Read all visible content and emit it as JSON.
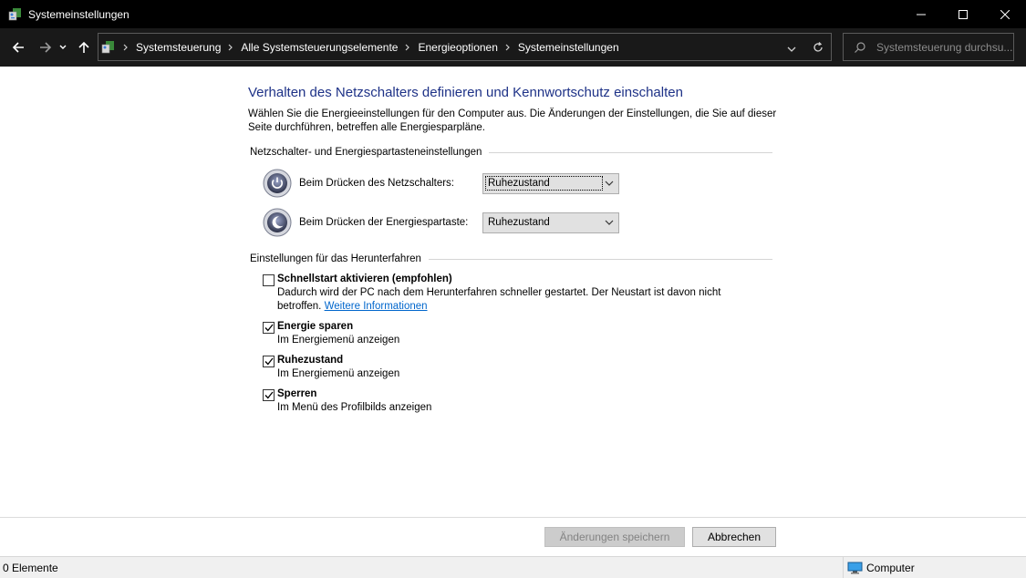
{
  "window": {
    "title": "Systemeinstellungen",
    "controls": [
      "minimize-icon",
      "maximize-icon",
      "close-icon"
    ]
  },
  "address": {
    "breadcrumbs": [
      "Systemsteuerung",
      "Alle Systemsteuerungselemente",
      "Energieoptionen",
      "Systemeinstellungen"
    ],
    "search_placeholder": "Systemsteuerung durchsu..."
  },
  "page": {
    "title": "Verhalten des Netzschalters definieren und Kennwortschutz einschalten",
    "description": "Wählen Sie die Energieeinstellungen für den Computer aus. Die Änderungen der Einstellungen, die Sie auf dieser Seite durchführen, betreffen alle Energiesparpläne."
  },
  "power_section": {
    "header": "Netzschalter- und Energiespartasteneinstellungen",
    "settings": [
      {
        "label": "Beim Drücken des Netzschalters:",
        "value": "Ruhezustand",
        "icon": "power-button-icon"
      },
      {
        "label": "Beim Drücken der Energiespartaste:",
        "value": "Ruhezustand",
        "icon": "sleep-button-icon"
      }
    ]
  },
  "shutdown_section": {
    "header": "Einstellungen für das Herunterfahren",
    "items": [
      {
        "label": "Schnellstart aktivieren (empfohlen)",
        "checked": false,
        "desc": "Dadurch wird der PC nach dem Herunterfahren schneller gestartet. Der Neustart ist davon nicht betroffen.",
        "link": "Weitere Informationen"
      },
      {
        "label": "Energie sparen",
        "checked": true,
        "desc": "Im Energiemenü anzeigen"
      },
      {
        "label": "Ruhezustand",
        "checked": true,
        "desc": "Im Energiemenü anzeigen"
      },
      {
        "label": "Sperren",
        "checked": true,
        "desc": "Im Menü des Profilbilds anzeigen"
      }
    ]
  },
  "buttons": {
    "save": "Änderungen speichern",
    "cancel": "Abbrechen"
  },
  "status": {
    "left": "0 Elemente",
    "right": "Computer"
  },
  "colors": {
    "title_blue": "#1e3287",
    "link_blue": "#0066cc",
    "titlebar_bg": "#000000"
  }
}
